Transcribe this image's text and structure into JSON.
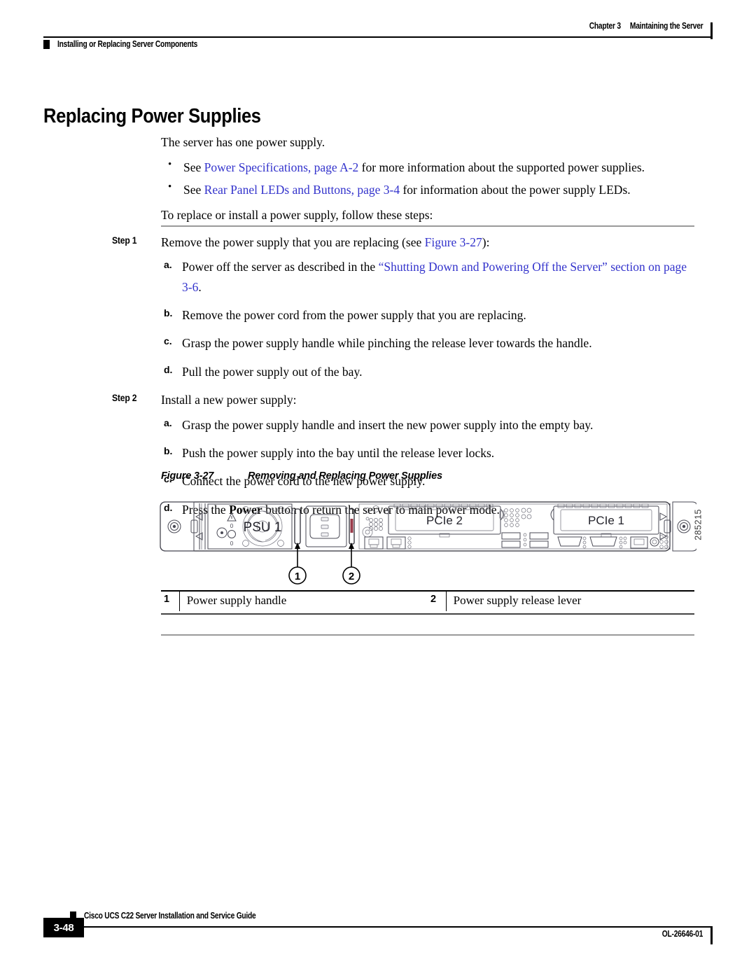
{
  "header": {
    "chapter_number": "Chapter 3",
    "chapter_title": "Maintaining the Server",
    "section_title": "Installing or Replacing Server Components"
  },
  "page_title": "Replacing Power Supplies",
  "intro": {
    "lead": "The server has one power supply.",
    "bullets": [
      {
        "pre": "See ",
        "link": "Power Specifications, page A-2",
        "post": " for more information about the supported power supplies."
      },
      {
        "pre": "See ",
        "link": "Rear Panel LEDs and Buttons, page 3-4",
        "post": " for information about the power supply LEDs."
      }
    ],
    "closing": "To replace or install a power supply, follow these steps:"
  },
  "steps": [
    {
      "label": "Step 1",
      "text_pre": "Remove the power supply that you are replacing (see ",
      "text_link": "Figure 3-27",
      "text_post": "):",
      "substeps": [
        {
          "marker": "a.",
          "pre": "Power off the server as described in the ",
          "link": "“Shutting Down and Powering Off the Server” section on page 3-6",
          "post": "."
        },
        {
          "marker": "b.",
          "pre": "Remove the power cord from the power supply that you are replacing.",
          "link": "",
          "post": ""
        },
        {
          "marker": "c.",
          "pre": "Grasp the power supply handle while pinching the release lever towards the handle.",
          "link": "",
          "post": ""
        },
        {
          "marker": "d.",
          "pre": "Pull the power supply out of the bay.",
          "link": "",
          "post": ""
        }
      ]
    },
    {
      "label": "Step 2",
      "text_pre": "Install a new power supply:",
      "text_link": "",
      "text_post": "",
      "substeps": [
        {
          "marker": "a.",
          "pre": "Grasp the power supply handle and insert the new power supply into the empty bay.",
          "link": "",
          "post": ""
        },
        {
          "marker": "b.",
          "pre": "Push the power supply into the bay until the release lever locks.",
          "link": "",
          "post": ""
        },
        {
          "marker": "c.",
          "pre": "Connect the power cord to the new power supply.",
          "link": "",
          "post": ""
        },
        {
          "marker": "d.",
          "pre": "Press the ",
          "bold": "Power",
          "post": " button to return the server to main power mode."
        }
      ]
    }
  ],
  "figure": {
    "number": "Figure 3-27",
    "title": "Removing and Replacing Power Supplies",
    "image_id": "285215",
    "labels": {
      "psu": "PSU 1",
      "pcie2": "PCIe 2",
      "pcie1": "PCIe 1"
    },
    "callouts": [
      {
        "num": "1"
      },
      {
        "num": "2"
      }
    ]
  },
  "legend": {
    "rows": [
      {
        "num": "1",
        "text": "Power supply handle",
        "num2": "2",
        "text2": "Power supply release lever"
      }
    ]
  },
  "footer": {
    "guide_title": "Cisco UCS C22 Server Installation and Service Guide",
    "page_number": "3-48",
    "doc_id": "OL-26646-01"
  },
  "colors": {
    "link": "#3333cc",
    "rule": "#9a9a9a",
    "line_art": "#3c3c46"
  }
}
